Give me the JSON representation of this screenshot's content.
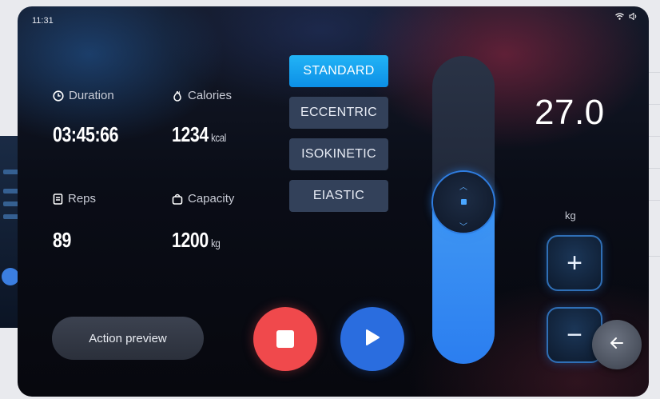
{
  "status": {
    "time": "11:31",
    "wifi_icon": "wifi-icon",
    "sound_icon": "speaker-icon"
  },
  "metrics": {
    "duration": {
      "label": "Duration",
      "value": "03:45:66",
      "icon": "clock-icon"
    },
    "calories": {
      "label": "Calories",
      "value": "1234",
      "unit": "kcal",
      "icon": "flame-icon"
    },
    "reps": {
      "label": "Reps",
      "value": "89",
      "icon": "document-icon"
    },
    "capacity": {
      "label": "Capacity",
      "value": "1200",
      "unit": "kg",
      "icon": "weight-icon"
    }
  },
  "modes": [
    {
      "label": "STANDARD",
      "active": true
    },
    {
      "label": "ECCENTRIC",
      "active": false
    },
    {
      "label": "ISOKINETIC",
      "active": false
    },
    {
      "label": "EIASTIC",
      "active": false
    }
  ],
  "weight": {
    "value": "27.0",
    "unit": "kg",
    "slider_level": 0.5
  },
  "controls": {
    "action_preview": "Action preview",
    "plus": "+",
    "minus": "−",
    "back_icon": "arrow-left-icon",
    "stop_icon": "stop-icon",
    "play_icon": "play-icon"
  },
  "colors": {
    "accent_blue": "#2b7ef0",
    "active_mode": "#22b4f6",
    "stop_red": "#f0494c",
    "play_blue": "#2a6ddf"
  }
}
